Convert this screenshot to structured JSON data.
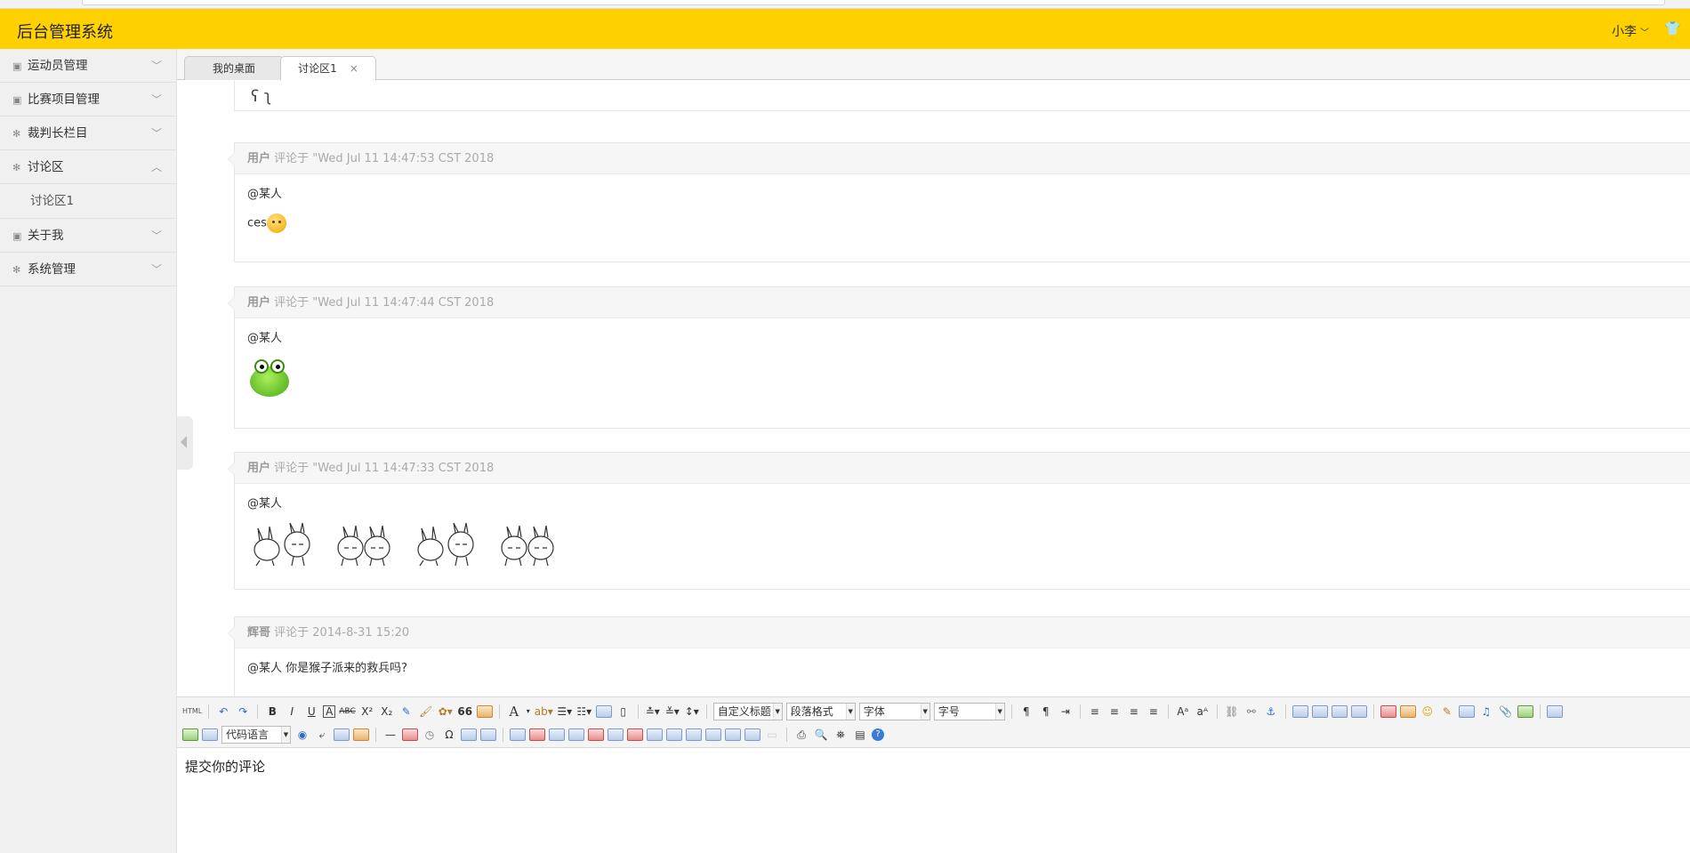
{
  "app": {
    "title": "后台管理系统",
    "user": "小李",
    "theme_icon": "tshirt-icon"
  },
  "sidebar": {
    "items": [
      {
        "label": "运动员管理",
        "icon": "image-icon",
        "chevron": "﹀"
      },
      {
        "label": "比赛项目管理",
        "icon": "image-icon",
        "chevron": "﹀"
      },
      {
        "label": "裁判长栏目",
        "icon": "gear-icon",
        "chevron": "﹀"
      },
      {
        "label": "讨论区",
        "icon": "gear-icon",
        "chevron": "︿"
      },
      {
        "label": "关于我",
        "icon": "image-icon",
        "chevron": "﹀"
      },
      {
        "label": "系统管理",
        "icon": "gear-icon",
        "chevron": "﹀"
      }
    ],
    "sub_items": [
      {
        "label": "讨论区1"
      }
    ]
  },
  "tabs": [
    {
      "label": "我的桌面"
    },
    {
      "label": "讨论区1",
      "close": "×"
    }
  ],
  "comments": [
    {
      "author": "用户",
      "meta": "评论于 \"Wed Jul 11 14:47:53 CST 2018",
      "mention": "@某人",
      "text": "ces",
      "media": "smiley-emoji"
    },
    {
      "author": "用户",
      "meta": "评论于 \"Wed Jul 11 14:47:44 CST 2018",
      "mention": "@某人",
      "text": "",
      "media": "frog-emoji"
    },
    {
      "author": "用户",
      "meta": "评论于 \"Wed Jul 11 14:47:33 CST 2018",
      "mention": "@某人",
      "text": "",
      "media": "bunny-stickers"
    },
    {
      "author": "辉哥",
      "meta": "评论于 2014-8-31 15:20",
      "mention": "@某人",
      "text": "你是猴子派来的救兵吗?"
    }
  ],
  "toolbar": {
    "html_label": "HTML",
    "bold": "B",
    "italic": "I",
    "underline": "U",
    "font_border": "A",
    "strike": "ABC",
    "superscript": "X²",
    "subscript": "X₂",
    "quote": "66",
    "font_color": "A",
    "select_heading": "自定义标题",
    "select_paragraph": "段落格式",
    "select_font": "字体",
    "select_size": "字号",
    "select_code": "代码语言",
    "omega": "Ω",
    "hr": "—",
    "dir_ltr": "¶",
    "dir_rtl": "¶",
    "help": "?"
  },
  "editor": {
    "placeholder": "提交你的评论"
  }
}
